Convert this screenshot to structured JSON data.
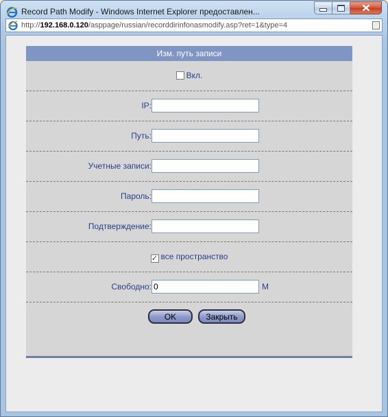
{
  "window": {
    "title": "Record Path Modify - Windows Internet Explorer предоставлен...",
    "url_prefix": "http://",
    "url_host": "192.168.0.120",
    "url_path": "/asppage/russian/recorddirinfonasmodify.asp?ret=1&type=4"
  },
  "panel": {
    "header": "Изм. путь записи",
    "enable_label": "Вкл.",
    "enable_checked": false,
    "ip_label": "IP:",
    "ip_value": "",
    "path_label": "Путь:",
    "path_value": "",
    "account_label": "Учетные записи:",
    "account_value": "",
    "password_label": "Пароль:",
    "password_value": "",
    "confirm_label": "Подтверждение:",
    "confirm_value": "",
    "all_space_label": "все пространство",
    "all_space_checked": true,
    "free_label": "Свободно:",
    "free_value": "0",
    "free_unit": "M",
    "ok_label": "OK",
    "close_label": "Закрыть"
  },
  "colors": {
    "header_bg": "#7f95c4",
    "label_text": "#2c3e8c",
    "panel_bg": "#d6d6d6"
  },
  "icons": {
    "title": "ie-icon",
    "address": "ie-page-icon",
    "compat": "compat-view-icon"
  }
}
